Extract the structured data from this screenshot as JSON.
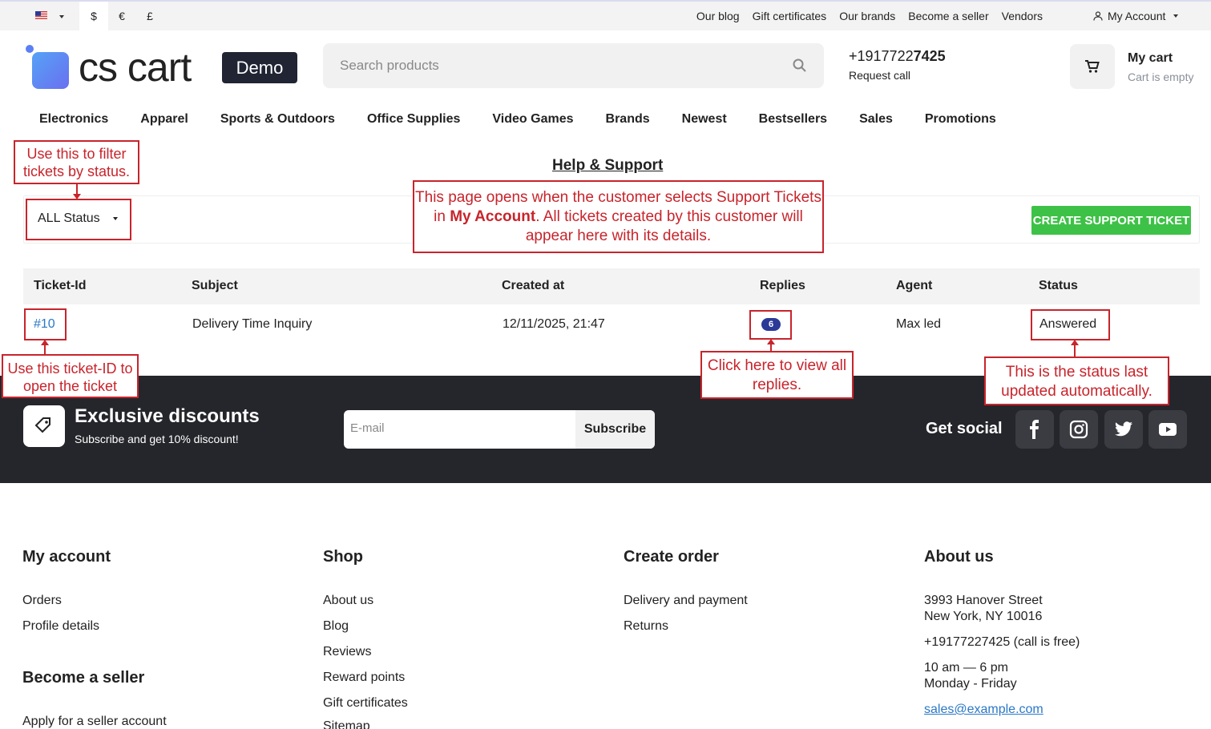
{
  "topbar": {
    "currencies": [
      "$",
      "€",
      "£"
    ],
    "links": [
      "Our blog",
      "Gift certificates",
      "Our brands",
      "Become a seller",
      "Vendors"
    ],
    "account": "My Account"
  },
  "header": {
    "logo_text": "cs cart",
    "logo_badge": "Demo",
    "search_placeholder": "Search products",
    "phone_prefix": "+1917722",
    "phone_bold": "7425",
    "request_call": "Request call",
    "cart_title": "My cart",
    "cart_status": "Cart is empty"
  },
  "nav": [
    "Electronics",
    "Apparel",
    "Sports & Outdoors",
    "Office Supplies",
    "Video Games",
    "Brands",
    "Newest",
    "Bestsellers",
    "Sales",
    "Promotions"
  ],
  "page": {
    "title": "Help & Support",
    "status_filter": "ALL Status",
    "create_button": "CREATE SUPPORT TICKET"
  },
  "table": {
    "headers": [
      "Ticket-Id",
      "Subject",
      "Created at",
      "Replies",
      "Agent",
      "Status"
    ],
    "rows": [
      {
        "id": "#10",
        "subject": "Delivery Time Inquiry",
        "created": "12/11/2025, 21:47",
        "replies": "6",
        "agent": "Max led",
        "status": "Answered"
      }
    ]
  },
  "annotations": {
    "filter": "Use this to filter tickets by status.",
    "page_pre": "This page opens when the customer selects Support Tickets in ",
    "page_bold": "My Account",
    "page_post": ". All tickets created by this customer will appear here with its details.",
    "ticket": "Use this ticket-ID to open the ticket",
    "replies": "Click here to view all replies.",
    "status": "This is the status last updated automatically."
  },
  "subscribe": {
    "title": "Exclusive discounts",
    "subtitle": "Subscribe and get 10% discount!",
    "email_placeholder": "E-mail",
    "button": "Subscribe",
    "social_title": "Get social"
  },
  "footer": {
    "my_account": {
      "title": "My account",
      "links": [
        "Orders",
        "Profile details"
      ]
    },
    "become_seller": {
      "title": "Become a seller",
      "links": [
        "Apply for a seller account"
      ]
    },
    "shop": {
      "title": "Shop",
      "links": [
        "About us",
        "Blog",
        "Reviews",
        "Reward points",
        "Gift certificates",
        "Sitemap"
      ]
    },
    "create_order": {
      "title": "Create order",
      "links": [
        "Delivery and payment",
        "Returns"
      ]
    },
    "about": {
      "title": "About us",
      "address1": "3993 Hanover Street",
      "address2": "New York, NY 10016",
      "phone": "+19177227425 (call is free)",
      "hours1": "10 am — 6 pm",
      "hours2": "Monday - Friday",
      "email": "sales@example.com"
    }
  },
  "colors": {
    "accent_green": "#3ec147",
    "link_blue": "#2a78c7",
    "annotation_red": "#c8242b",
    "dark_footer": "#25262b"
  }
}
